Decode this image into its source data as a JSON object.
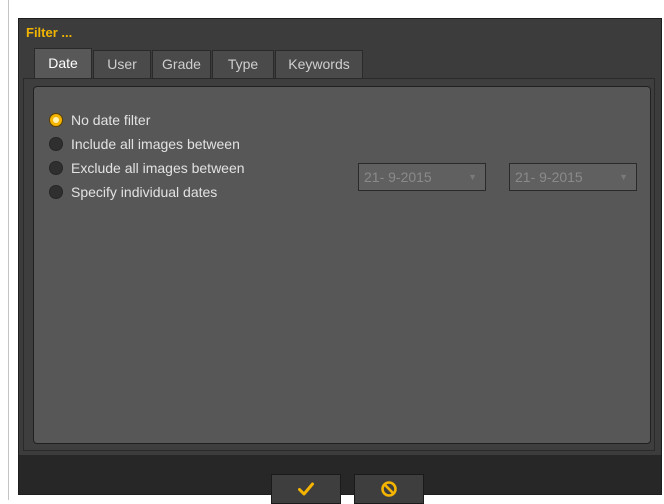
{
  "dialog": {
    "title": "Filter ..."
  },
  "tabs": [
    {
      "label": "Date",
      "active": true
    },
    {
      "label": "User",
      "active": false
    },
    {
      "label": "Grade",
      "active": false
    },
    {
      "label": "Type",
      "active": false
    },
    {
      "label": "Keywords",
      "active": false
    }
  ],
  "date_filter": {
    "options": [
      {
        "label": "No date filter",
        "checked": true
      },
      {
        "label": "Include all images between",
        "checked": false
      },
      {
        "label": "Exclude all images between",
        "checked": false
      },
      {
        "label": "Specify individual dates",
        "checked": false
      }
    ],
    "from_date": "21- 9-2015",
    "separator": "-",
    "to_date": "21- 9-2015"
  },
  "footer": {
    "ok_icon": "checkmark-icon",
    "cancel_icon": "cancel-icon"
  },
  "colors": {
    "accent": "#f0b400",
    "background": "#3c3c3c",
    "panel": "#575757"
  }
}
